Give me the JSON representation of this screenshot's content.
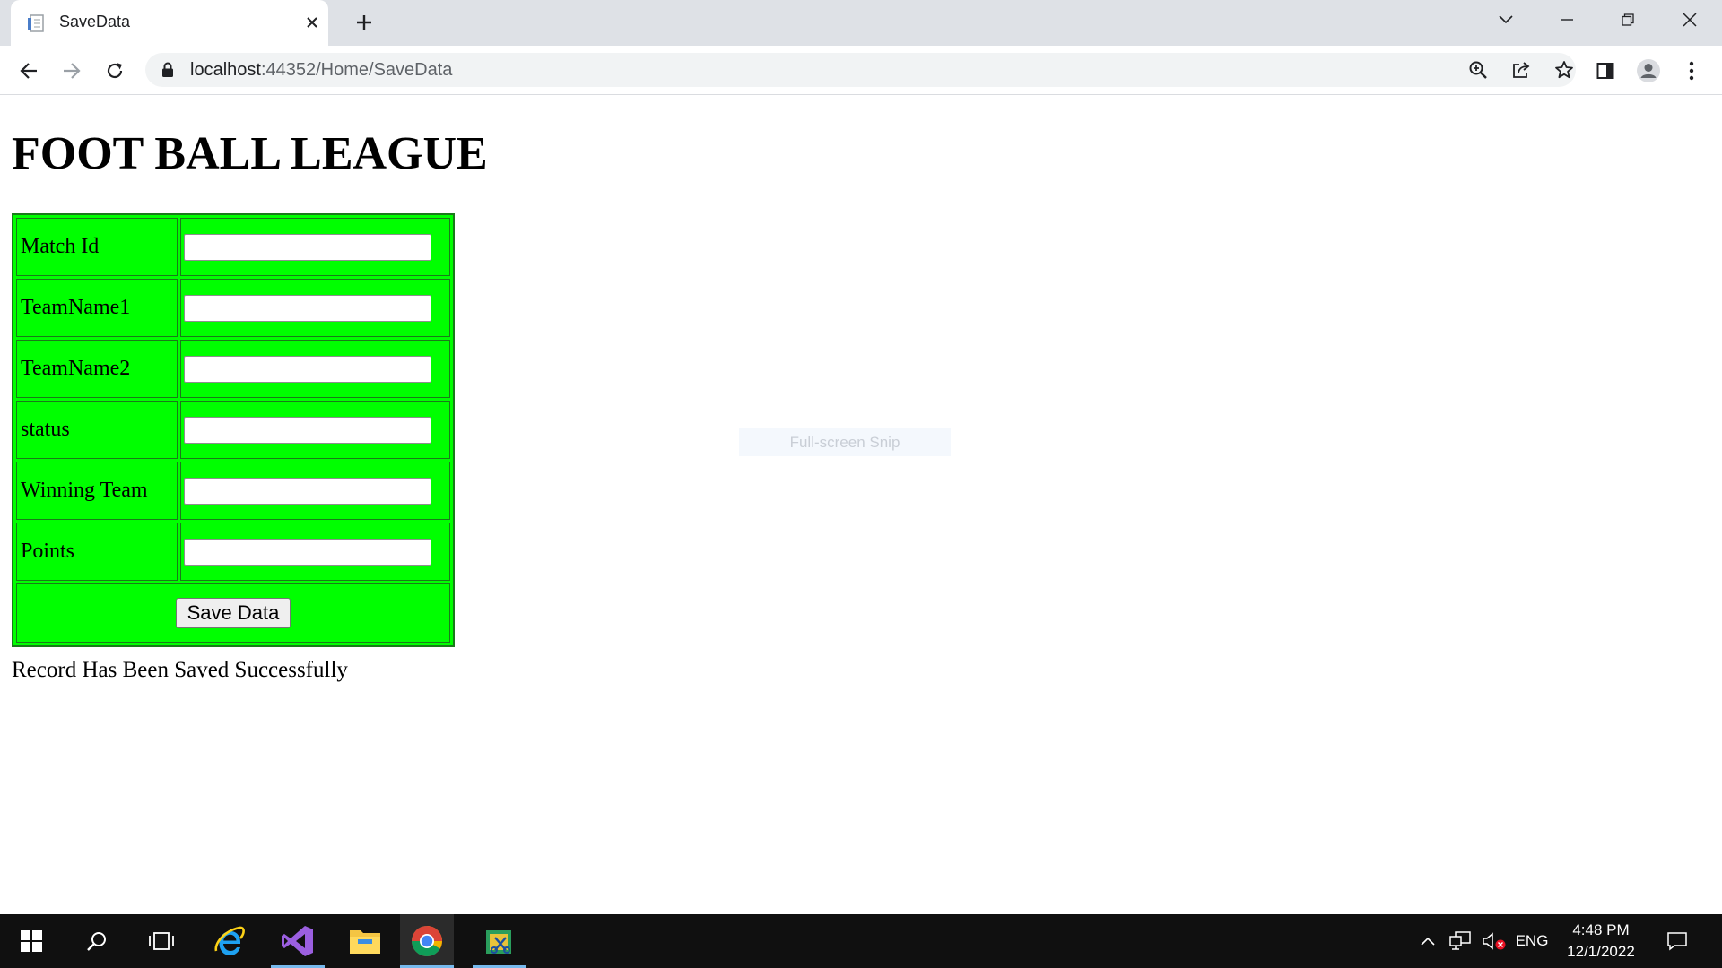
{
  "browser": {
    "tab": {
      "title": "SaveData"
    },
    "address": {
      "host": "localhost",
      "rest": ":44352/Home/SaveData"
    }
  },
  "page": {
    "title": "FOOT BALL LEAGUE",
    "form": {
      "fields": [
        {
          "label": "Match Id",
          "value": ""
        },
        {
          "label": "TeamName1",
          "value": ""
        },
        {
          "label": "TeamName2",
          "value": ""
        },
        {
          "label": "status",
          "value": ""
        },
        {
          "label": "Winning Team",
          "value": ""
        },
        {
          "label": "Points",
          "value": ""
        }
      ],
      "submit_label": "Save Data"
    },
    "message": "Record Has Been Saved Successfully",
    "overlay": "Full-screen Snip"
  },
  "taskbar": {
    "language": "ENG",
    "time": "4:48 PM",
    "date": "12/1/2022"
  },
  "colors": {
    "form_background": "#00ff00",
    "form_border": "#1a7a1a",
    "tabstrip": "#dee1e6",
    "taskbar": "#101010"
  }
}
